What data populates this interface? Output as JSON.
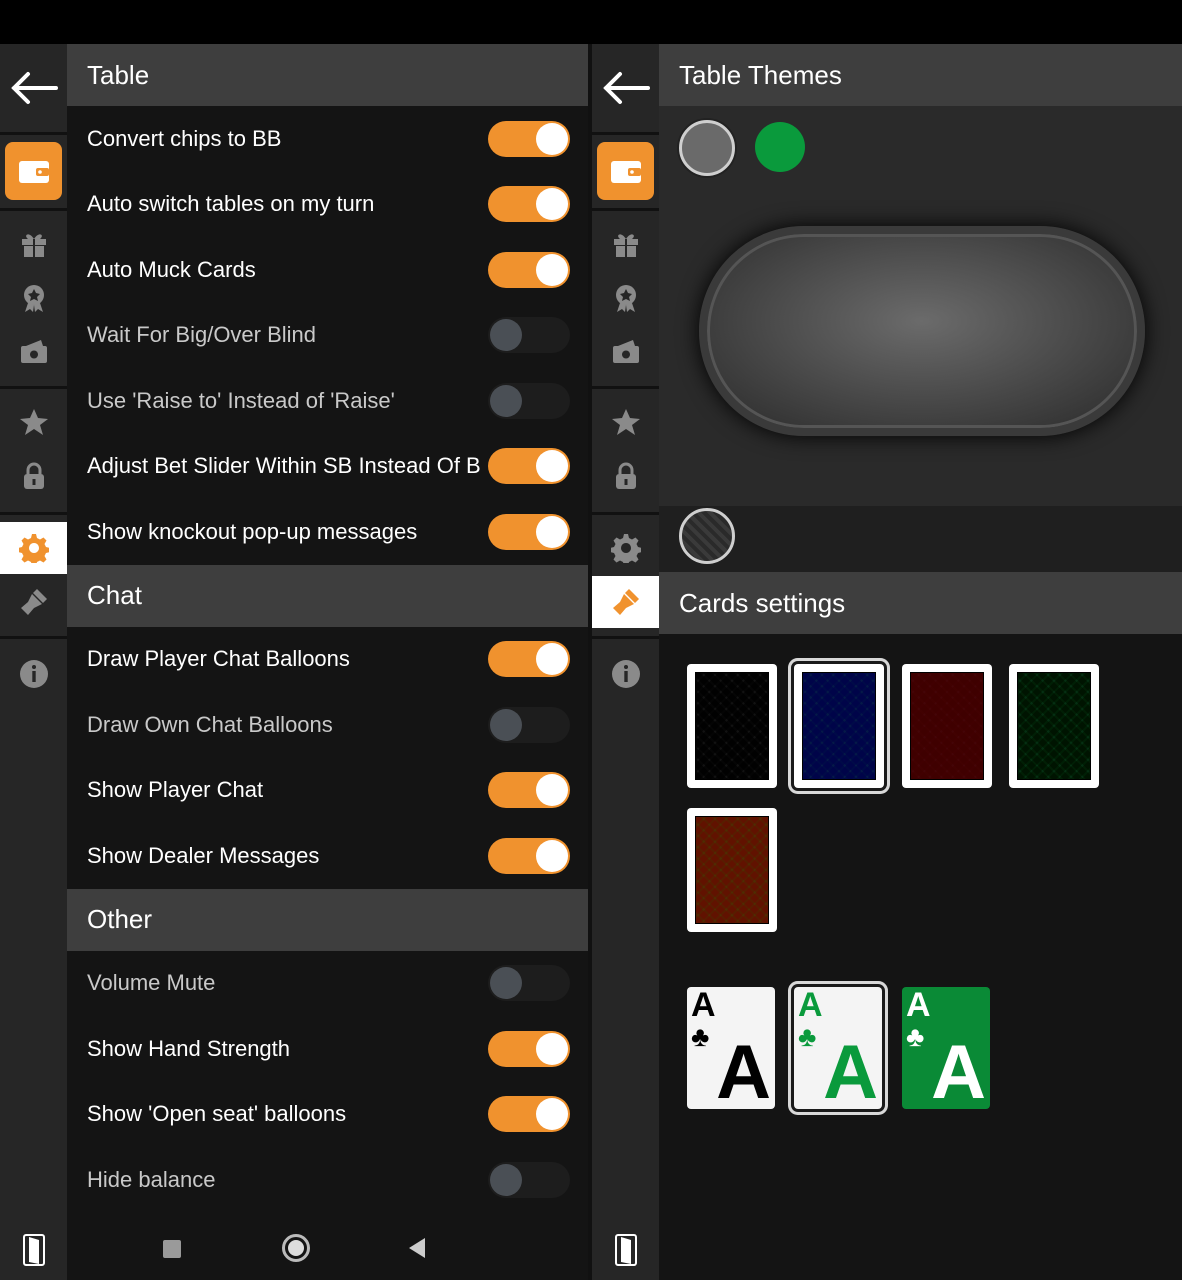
{
  "left": {
    "header": "Table",
    "table_settings": [
      {
        "label": "Convert chips to BB",
        "on": true
      },
      {
        "label": "Auto switch tables on my turn",
        "on": true
      },
      {
        "label": "Auto Muck Cards",
        "on": true
      },
      {
        "label": "Wait For Big/Over Blind",
        "on": false
      },
      {
        "label": "Use 'Raise to' Instead of 'Raise'",
        "on": false
      },
      {
        "label": "Adjust Bet Slider Within SB Instead Of BB",
        "on": true
      },
      {
        "label": "Show knockout pop-up messages",
        "on": true
      }
    ],
    "chat_header": "Chat",
    "chat_settings": [
      {
        "label": "Draw Player Chat Balloons",
        "on": true
      },
      {
        "label": "Draw Own Chat Balloons",
        "on": false
      },
      {
        "label": "Show Player Chat",
        "on": true
      },
      {
        "label": "Show Dealer Messages",
        "on": true
      }
    ],
    "other_header": "Other",
    "other_settings": [
      {
        "label": "Volume Mute",
        "on": false
      },
      {
        "label": "Show Hand Strength",
        "on": true
      },
      {
        "label": "Show 'Open seat' balloons",
        "on": true
      },
      {
        "label": "Hide balance",
        "on": false
      }
    ]
  },
  "right": {
    "header": "Table Themes",
    "theme_colors": [
      "#6a6a6a",
      "#0a9a3c"
    ],
    "cards_header": "Cards settings",
    "card_backs": [
      {
        "color": "#2a2a2a",
        "selected": false
      },
      {
        "color": "#0b3ea8",
        "selected": true
      },
      {
        "color": "#a00d12",
        "selected": false
      },
      {
        "color": "#0d6e2c",
        "selected": false
      },
      {
        "color": "#b96a05",
        "selected": false
      }
    ],
    "card_faces": [
      {
        "rank": "A",
        "suit": "♣",
        "bg": "#f4f4f4",
        "fg": "#000000",
        "selected": false
      },
      {
        "rank": "A",
        "suit": "♣",
        "bg": "#f4f4f4",
        "fg": "#0a9a3c",
        "selected": true
      },
      {
        "rank": "A",
        "suit": "♣",
        "bg": "#0a8a36",
        "fg": "#ffffff",
        "selected": false
      }
    ]
  },
  "colors": {
    "accent": "#f0922e",
    "header_bg": "#3e3e3e",
    "rail_bg": "#262626"
  },
  "icons": [
    "back-arrow-icon",
    "wallet-icon",
    "gift-icon",
    "award-icon",
    "cash-icon",
    "star-icon",
    "lock-icon",
    "gear-icon",
    "brush-icon",
    "info-icon",
    "exit-icon"
  ]
}
